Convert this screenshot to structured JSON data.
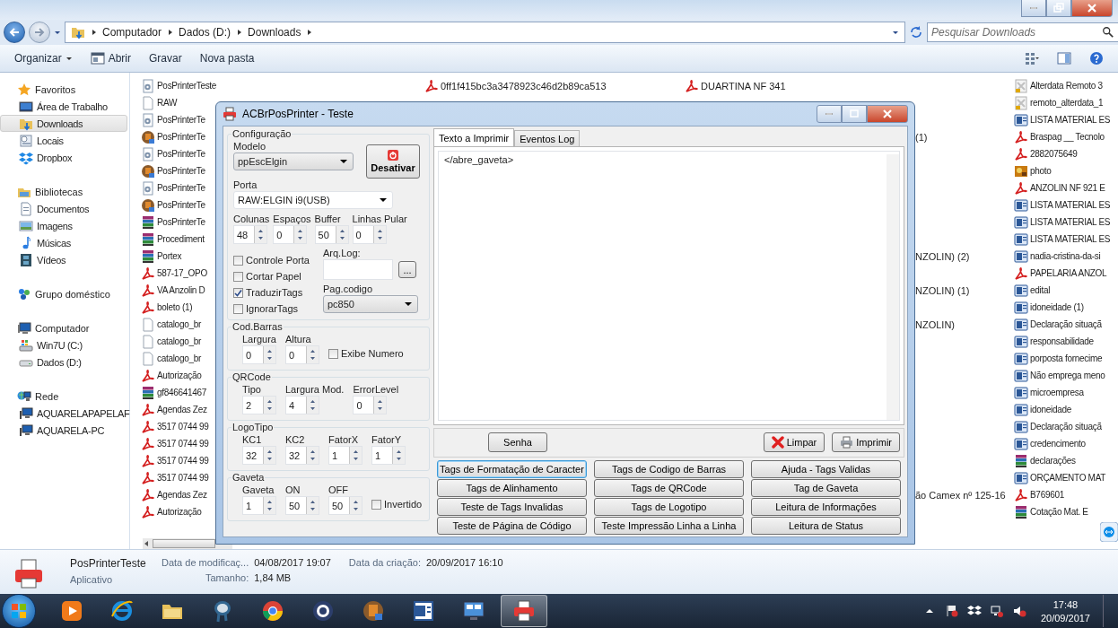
{
  "address": {
    "breadcrumbs": [
      "Computador",
      "Dados (D:)",
      "Downloads"
    ],
    "search": {
      "placeholder": "Pesquisar Downloads"
    }
  },
  "toolbar": {
    "items": [
      {
        "label": "Organizar",
        "kind": "menu"
      },
      {
        "label": "Abrir",
        "kind": "icon"
      },
      {
        "label": "Gravar",
        "kind": "plain"
      },
      {
        "label": "Nova pasta",
        "kind": "plain"
      }
    ]
  },
  "nav": {
    "groups": [
      {
        "label": "Favoritos",
        "kind": "star",
        "children": [
          {
            "label": "Área de Trabalho",
            "kind": "desktop",
            "selected": false
          },
          {
            "label": "Downloads",
            "kind": "folder",
            "selected": true
          },
          {
            "label": "Locais",
            "kind": "places",
            "selected": false
          },
          {
            "label": "Dropbox",
            "kind": "dropbox",
            "selected": false
          }
        ]
      },
      {
        "label": "Bibliotecas",
        "kind": "library",
        "children": [
          {
            "label": "Documentos",
            "kind": "document",
            "selected": false
          },
          {
            "label": "Imagens",
            "kind": "image",
            "selected": false
          },
          {
            "label": "Músicas",
            "kind": "music",
            "selected": false
          },
          {
            "label": "Vídeos",
            "kind": "video",
            "selected": false
          }
        ]
      },
      {
        "label": "Grupo doméstico",
        "kind": "homegroup"
      },
      {
        "label": "Computador",
        "kind": "computer",
        "children": [
          {
            "label": "Win7U (C:)",
            "kind": "system-drive",
            "selected": false
          },
          {
            "label": "Dados (D:)",
            "kind": "drive",
            "selected": false
          }
        ]
      },
      {
        "label": "Rede",
        "kind": "network",
        "children": [
          {
            "label": "AQUARELAPAPELAF",
            "kind": "pc",
            "selected": false
          },
          {
            "label": "AQUARELA-PC",
            "kind": "pc",
            "selected": false
          }
        ]
      }
    ]
  },
  "files": {
    "rows": [
      {
        "column_1": {
          "name": "PosPrinterTeste",
          "kind": "gear"
        },
        "column_2": {
          "name": "0ff1f415bc3a3478923c46d2b89ca513",
          "kind": "pdf"
        },
        "column_3": {
          "name": "DUARTINA NF 341",
          "kind": "pdf"
        },
        "column_4": {
          "name": "Alterdata Remoto 3",
          "kind": "remote"
        }
      },
      {
        "column_1": {
          "name": "RAW",
          "kind": "blank"
        },
        "column_4": {
          "name": "remoto_alterdata_1",
          "kind": "remote"
        }
      },
      {
        "column_1": {
          "name": "PosPrinterTe",
          "kind": "gear"
        },
        "column_4": {
          "name": "LISTA MATERIAL ES",
          "kind": "word"
        }
      },
      {
        "column_1": {
          "name": "PosPrinterTe",
          "kind": "app"
        },
        "column_3_tail": "(1)",
        "column_4": {
          "name": "Braspag __ Tecnolo",
          "kind": "pdf"
        }
      },
      {
        "column_1": {
          "name": "PosPrinterTe",
          "kind": "gear"
        },
        "column_4": {
          "name": "2882075649",
          "kind": "pdf"
        }
      },
      {
        "column_1": {
          "name": "PosPrinterTe",
          "kind": "app"
        },
        "column_4": {
          "name": "photo",
          "kind": "photo"
        }
      },
      {
        "column_1": {
          "name": "PosPrinterTe",
          "kind": "gear"
        },
        "column_4": {
          "name": "ANZOLIN NF 921 E",
          "kind": "pdf"
        }
      },
      {
        "column_1": {
          "name": "PosPrinterTe",
          "kind": "app"
        },
        "column_4": {
          "name": "LISTA MATERIAL ES",
          "kind": "word"
        }
      },
      {
        "column_1": {
          "name": "PosPrinterTe",
          "kind": "archive"
        },
        "column_4": {
          "name": "LISTA MATERIAL ES",
          "kind": "word"
        }
      },
      {
        "column_1": {
          "name": "Procediment",
          "kind": "archive"
        },
        "column_4": {
          "name": "LISTA MATERIAL ES",
          "kind": "word"
        }
      },
      {
        "column_1": {
          "name": "Portex",
          "kind": "archive"
        },
        "column_3_tail": "NZOLIN) (2)",
        "column_4": {
          "name": "nadia-cristina-da-si",
          "kind": "word"
        }
      },
      {
        "column_1": {
          "name": "587-17_OPO",
          "kind": "pdf"
        },
        "column_4": {
          "name": "PAPELARIA ANZOL",
          "kind": "pdf"
        }
      },
      {
        "column_1": {
          "name": "VA Anzolin D",
          "kind": "pdf"
        },
        "column_3_tail": "NZOLIN) (1)",
        "column_4": {
          "name": "edital",
          "kind": "word"
        }
      },
      {
        "column_1": {
          "name": "boleto (1)",
          "kind": "pdf"
        },
        "column_4": {
          "name": "idoneidade (1)",
          "kind": "word"
        }
      },
      {
        "column_1": {
          "name": "catalogo_br",
          "kind": "blank"
        },
        "column_3_tail": "NZOLIN)",
        "column_4": {
          "name": "Declaração situaçã",
          "kind": "word"
        }
      },
      {
        "column_1": {
          "name": "catalogo_br",
          "kind": "blank"
        },
        "column_4": {
          "name": "responsabilidade",
          "kind": "word"
        }
      },
      {
        "column_1": {
          "name": "catalogo_br",
          "kind": "blank"
        },
        "column_4": {
          "name": "porposta fornecime",
          "kind": "word"
        }
      },
      {
        "column_1": {
          "name": "Autorização",
          "kind": "pdf"
        },
        "column_4": {
          "name": "Não emprega meno",
          "kind": "word"
        }
      },
      {
        "column_1": {
          "name": "gf846641467",
          "kind": "archive"
        },
        "column_4": {
          "name": "microempresa",
          "kind": "word"
        }
      },
      {
        "column_1": {
          "name": "Agendas Zez",
          "kind": "pdf"
        },
        "column_4": {
          "name": "idoneidade",
          "kind": "word"
        }
      },
      {
        "column_1": {
          "name": "3517 0744 99",
          "kind": "pdf"
        },
        "column_4": {
          "name": "Declaração situaçã",
          "kind": "word"
        }
      },
      {
        "column_1": {
          "name": "3517 0744 99",
          "kind": "pdf"
        },
        "column_4": {
          "name": "credencimento",
          "kind": "word"
        }
      },
      {
        "column_1": {
          "name": "3517 0744 99",
          "kind": "pdf"
        },
        "column_4": {
          "name": "declarações",
          "kind": "archive"
        }
      },
      {
        "column_1": {
          "name": "3517 0744 99",
          "kind": "pdf"
        },
        "column_4": {
          "name": "ORÇAMENTO MAT",
          "kind": "word"
        }
      },
      {
        "column_1": {
          "name": "Agendas Zez",
          "kind": "pdf"
        },
        "column_3_tail": "ão Camex nº 125-16",
        "column_4": {
          "name": "B769601",
          "kind": "pdf"
        }
      },
      {
        "column_1": {
          "name": "Autorização",
          "kind": "pdf"
        },
        "column_4": {
          "name": "Cotação Mat. E",
          "kind": "archive"
        }
      }
    ]
  },
  "dialog": {
    "title": "ACBrPosPrinter - Teste",
    "config": {
      "title": "Configuração",
      "model": {
        "label": "Modelo",
        "value": "ppEscElgin"
      },
      "toggle_button": "Desativar",
      "port": {
        "label": "Porta",
        "value": "RAW:ELGIN i9(USB)"
      },
      "spins": [
        {
          "label": "Colunas",
          "value": "48"
        },
        {
          "label": "Espaços",
          "value": "0"
        },
        {
          "label": "Buffer",
          "value": "50"
        },
        {
          "label": "Linhas Pular",
          "value": "0"
        }
      ],
      "checkboxes": [
        {
          "label": "Controle Porta",
          "checked": false
        },
        {
          "label": "Cortar Papel",
          "checked": false
        },
        {
          "label": "TraduzirTags",
          "checked": true
        },
        {
          "label": "IgnorarTags",
          "checked": false
        }
      ],
      "log_file": {
        "label": "Arq.Log:",
        "button": "..."
      },
      "code_page": {
        "label": "Pag.codigo",
        "value": "pc850"
      }
    },
    "sections": [
      {
        "title": "Cod.Barras",
        "items": [
          {
            "kind": "spin",
            "label": "Largura",
            "value": "0"
          },
          {
            "kind": "spin",
            "label": "Altura",
            "value": "0"
          },
          {
            "kind": "check",
            "label": "Exibe Numero",
            "checked": false
          }
        ]
      },
      {
        "title": "QRCode",
        "items": [
          {
            "kind": "spin",
            "label": "Tipo",
            "value": "2"
          },
          {
            "kind": "spin",
            "label": "Largura Mod.",
            "value": "4"
          },
          {
            "kind": "spin",
            "label": "ErrorLevel",
            "value": "0"
          }
        ]
      },
      {
        "title": "LogoTipo",
        "items": [
          {
            "kind": "spin",
            "label": "KC1",
            "value": "32"
          },
          {
            "kind": "spin",
            "label": "KC2",
            "value": "32"
          },
          {
            "kind": "spin",
            "label": "FatorX",
            "value": "1"
          },
          {
            "kind": "spin",
            "label": "FatorY",
            "value": "1"
          }
        ]
      },
      {
        "title": "Gaveta",
        "items": [
          {
            "kind": "spin",
            "label": "Gaveta",
            "value": "1"
          },
          {
            "kind": "spin",
            "label": "ON",
            "value": "50"
          },
          {
            "kind": "spin",
            "label": "OFF",
            "value": "50"
          },
          {
            "kind": "check",
            "label": "Invertido",
            "checked": false
          }
        ]
      }
    ],
    "tabs": [
      {
        "label": "Texto a Imprimir",
        "selected": true
      },
      {
        "label": "Eventos Log",
        "selected": false
      }
    ],
    "text": "</abre_gaveta>",
    "actions": [
      {
        "label": "Senha",
        "kind": "plain"
      },
      {
        "label": "Limpar",
        "kind": "clear"
      },
      {
        "label": "Imprimir",
        "kind": "print"
      }
    ],
    "buttons": [
      {
        "label": "Tags de Formatação de Caracter",
        "focused": true
      },
      {
        "label": "Tags de Codigo de Barras",
        "focused": false
      },
      {
        "label": "Ajuda - Tags Validas",
        "focused": false
      },
      {
        "label": "Tags de Alinhamento",
        "focused": false
      },
      {
        "label": "Tags de QRCode",
        "focused": false
      },
      {
        "label": "Tag de Gaveta",
        "focused": false
      },
      {
        "label": "Teste de Tags Invalidas",
        "focused": false
      },
      {
        "label": "Tags de Logotipo",
        "focused": false
      },
      {
        "label": "Leitura de Informações",
        "focused": false
      },
      {
        "label": "Teste de Página de Código",
        "focused": false
      },
      {
        "label": "Teste Impressão Linha a Linha",
        "focused": false
      },
      {
        "label": "Leitura de Status",
        "focused": false
      }
    ]
  },
  "details": {
    "name": "PosPrinterTeste",
    "type": "Aplicativo",
    "columns": [
      [
        {
          "label": "Data de modificaç...",
          "value": "04/08/2017 19:07"
        },
        {
          "label": "Tamanho:",
          "value": "1,84 MB"
        }
      ],
      [
        {
          "label": "Data da criação:",
          "value": "20/09/2017 16:10"
        }
      ]
    ]
  },
  "taskbar": {
    "apps": [
      {
        "kind": "media",
        "active": false
      },
      {
        "kind": "browser-e",
        "active": false
      },
      {
        "kind": "folder",
        "active": false
      },
      {
        "kind": "elephant",
        "active": false
      },
      {
        "kind": "chrome",
        "active": false
      },
      {
        "kind": "disc",
        "active": false
      },
      {
        "kind": "round-app",
        "active": false
      },
      {
        "kind": "word",
        "active": false
      },
      {
        "kind": "remote",
        "active": false
      },
      {
        "kind": "printer",
        "active": true
      }
    ],
    "tray": [
      {
        "kind": "caret"
      },
      {
        "kind": "flag"
      },
      {
        "kind": "dropbox"
      },
      {
        "kind": "network"
      },
      {
        "kind": "mute"
      }
    ],
    "clock": {
      "time": "17:48",
      "date": "20/09/2017"
    }
  }
}
